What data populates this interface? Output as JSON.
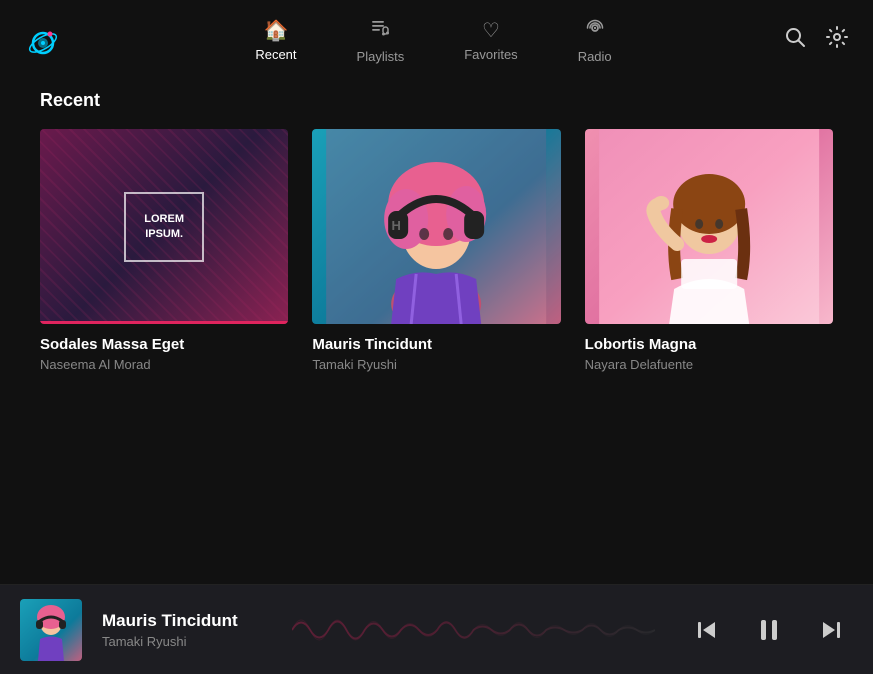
{
  "app": {
    "logo_alt": "Music App Logo"
  },
  "nav": {
    "items": [
      {
        "id": "recent",
        "label": "Recent",
        "icon": "🏠",
        "active": true
      },
      {
        "id": "playlists",
        "label": "Playlists",
        "icon": "🎵",
        "active": false
      },
      {
        "id": "favorites",
        "label": "Favorites",
        "icon": "♡",
        "active": false
      },
      {
        "id": "radio",
        "label": "Radio",
        "icon": "📡",
        "active": false
      }
    ],
    "search_label": "🔍",
    "settings_label": "⚙"
  },
  "main": {
    "section_title": "Recent",
    "cards": [
      {
        "title": "Sodales Massa Eget",
        "subtitle": "Naseema Al Morad",
        "thumb_text": "LOREM\nIPSUM."
      },
      {
        "title": "Mauris Tincidunt",
        "subtitle": "Tamaki Ryushi",
        "thumb_text": ""
      },
      {
        "title": "Lobortis Magna",
        "subtitle": "Nayara Delafuente",
        "thumb_text": ""
      }
    ]
  },
  "player": {
    "title": "Mauris Tincidunt",
    "artist": "Tamaki Ryushi",
    "controls": {
      "prev": "⏮",
      "play": "⏸",
      "next": "⏭"
    }
  }
}
